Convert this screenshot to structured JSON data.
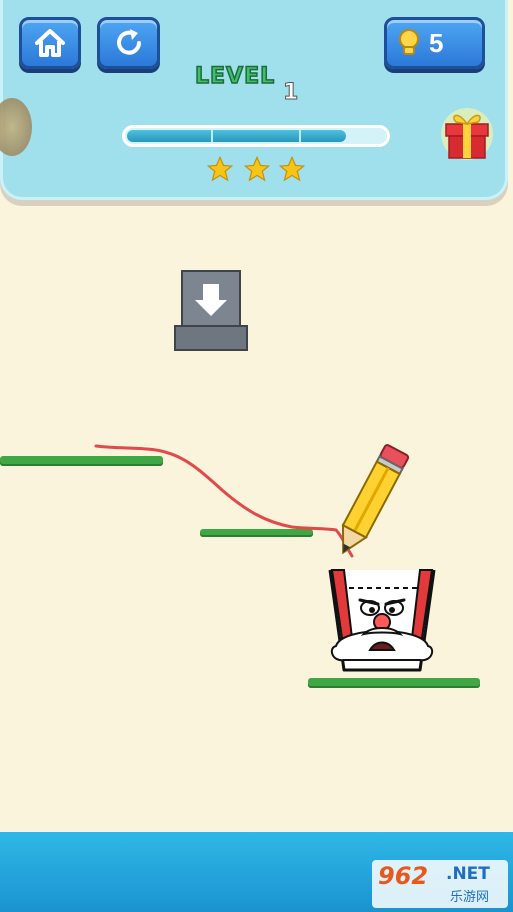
{
  "hud": {
    "level_label": "LEVEL",
    "level_number": "1",
    "hint_count": "5",
    "progress": 0.85,
    "stars": 3
  },
  "icons": {
    "home": "home-icon",
    "restart": "restart-icon",
    "hint": "lightbulb-icon",
    "gift": "gift-icon",
    "star": "star-icon",
    "spawner": "down-arrow-icon",
    "pencil": "pencil-icon",
    "cup": "cup-character"
  },
  "colors": {
    "panel": "#9fe0ec",
    "button": "#2b79d9",
    "platform": "#3fa845",
    "ink": "#e04a4a",
    "background": "#fbf4dd",
    "water": "#2fb8e6",
    "star": "#f5c518"
  },
  "watermark": {
    "main": "962",
    "net": ".NET",
    "sub": "乐游网"
  }
}
